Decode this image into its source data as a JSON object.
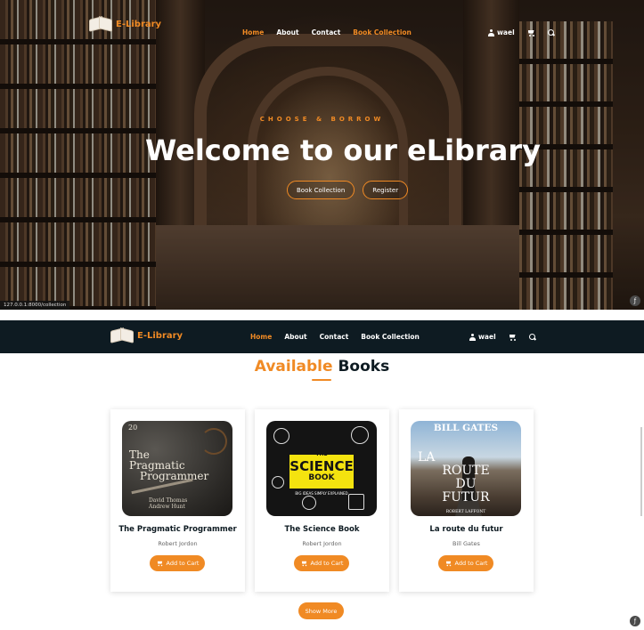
{
  "hero": {
    "brand": "E-Library",
    "nav": [
      "Home",
      "About",
      "Contact",
      "Book Collection"
    ],
    "user": "wael",
    "tagline": "CHOOSE & BORROW",
    "headline": "Welcome to our eLibrary",
    "buttons": [
      "Book Collection",
      "Register"
    ],
    "status_url": "127.0.0.1:8000/collection"
  },
  "page2": {
    "brand": "E-Library",
    "nav": [
      "Home",
      "About",
      "Contact",
      "Book Collection"
    ],
    "user": "wael",
    "title_highlight": "Available",
    "title_rest": " Books",
    "books": [
      {
        "title": "The Pragmatic Programmer",
        "author": "Robert Jordon",
        "cover_number": "20",
        "cover_title_1": "The",
        "cover_title_2": "Pragmatic",
        "cover_title_3": "Programmer",
        "cover_authors_1": "David Thomas",
        "cover_authors_2": "Andrew Hunt"
      },
      {
        "title": "The Science Book",
        "author": "Robert Jordon",
        "cover_top": "THE",
        "cover_main": "SCIENCE",
        "cover_sub": "BOOK",
        "cover_tag": "BIG IDEAS SIMPLY EXPLAINED"
      },
      {
        "title": "La route du futur",
        "author": "Bill Gates",
        "cover_author": "BILL GATES",
        "cover_line_1": "LA",
        "cover_line_2": "ROUTE",
        "cover_line_3": "DU",
        "cover_line_4": "FUTUR",
        "cover_publisher": "ROBERT LAFFONT"
      }
    ],
    "add_to_cart": "Add to Cart",
    "show_more": "Show More"
  },
  "colors": {
    "accent": "#f08a24",
    "navy": "#0e1b22"
  },
  "icons": [
    "user-icon",
    "cart-icon",
    "search-icon",
    "logo-book-icon"
  ]
}
